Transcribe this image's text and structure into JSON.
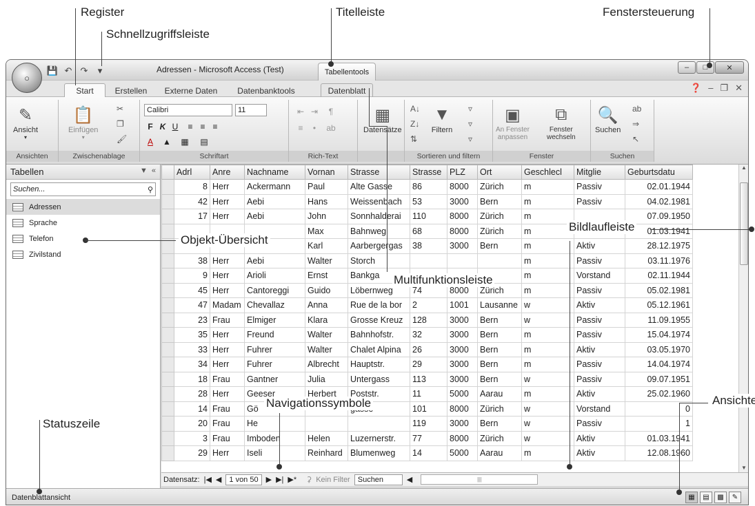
{
  "callouts": {
    "register": "Register",
    "schnellzugriff": "Schnellzugriffsleiste",
    "titelleiste": "Titelleiste",
    "fenstersteuerung": "Fenstersteuerung",
    "objektuebersicht": "Objekt-Übersicht",
    "bildlaufleiste": "Bildlaufleiste",
    "multifunktion": "Multifunktionsleiste",
    "statuszeile": "Statuszeile",
    "navigationssymbole": "Navigationssymbole",
    "ansichten": "Ansichten"
  },
  "window": {
    "title": "Adressen - Microsoft Access (Test)",
    "tool_tab": "Tabellentools"
  },
  "tabs": [
    "Start",
    "Erstellen",
    "Externe Daten",
    "Datenbanktools",
    "Datenblatt"
  ],
  "ribbon": {
    "groups": [
      "Ansichten",
      "Zwischenablage",
      "Schriftart",
      "Rich-Text",
      "",
      "Sortieren und filtern",
      "Fenster",
      "Suchen"
    ],
    "ansicht": "Ansicht",
    "einfuegen": "Einfügen",
    "font_name": "Calibri",
    "font_size": "11",
    "datensaetze": "Datensätze",
    "filtern": "Filtern",
    "an_fenster": "An Fenster",
    "anpassen": "anpassen",
    "fenster": "Fenster",
    "wechseln": "wechseln",
    "suchen": "Suchen"
  },
  "nav": {
    "header": "Tabellen",
    "search_placeholder": "Suchen...",
    "items": [
      "Adressen",
      "Sprache",
      "Telefon",
      "Zivilstand"
    ]
  },
  "table": {
    "columns": [
      "Adrl",
      "Anre",
      "Nachname",
      "Vornan",
      "Strasse",
      "Strasse",
      "PLZ",
      "Ort",
      "Geschlecl",
      "Mitglie",
      "Geburtsdatu"
    ],
    "rows": [
      [
        "8",
        "Herr",
        "Ackermann",
        "Paul",
        "Alte Gasse",
        "86",
        "8000",
        "Zürich",
        "m",
        "Passiv",
        "02.01.1944"
      ],
      [
        "42",
        "Herr",
        "Aebi",
        "Hans",
        "Weissenbach",
        "53",
        "3000",
        "Bern",
        "m",
        "Passiv",
        "04.02.1981"
      ],
      [
        "17",
        "Herr",
        "Aebi",
        "John",
        "Sonnhalderai",
        "110",
        "8000",
        "Zürich",
        "m",
        "",
        "07.09.1950"
      ],
      [
        "",
        "",
        "",
        "Max",
        "Bahnweg",
        "68",
        "8000",
        "Zürich",
        "m",
        "",
        "01.03.1941"
      ],
      [
        "",
        "",
        "",
        "Karl",
        "Aarbergergas",
        "38",
        "3000",
        "Bern",
        "m",
        "Aktiv",
        "28.12.1975"
      ],
      [
        "38",
        "Herr",
        "Aebi",
        "Walter",
        "Storch",
        "",
        "",
        "",
        "m",
        "Passiv",
        "03.11.1976"
      ],
      [
        "9",
        "Herr",
        "Arioli",
        "Ernst",
        "Bankga",
        "",
        "",
        "",
        "m",
        "Vorstand",
        "02.11.1944"
      ],
      [
        "45",
        "Herr",
        "Cantoreggi",
        "Guido",
        "Löbernweg",
        "74",
        "8000",
        "Zürich",
        "m",
        "Passiv",
        "05.02.1981"
      ],
      [
        "47",
        "Madam",
        "Chevallaz",
        "Anna",
        "Rue de la bor",
        "2",
        "1001",
        "Lausanne",
        "w",
        "Aktiv",
        "05.12.1961"
      ],
      [
        "23",
        "Frau",
        "Elmiger",
        "Klara",
        "Grosse Kreuz",
        "128",
        "3000",
        "Bern",
        "w",
        "Passiv",
        "11.09.1955"
      ],
      [
        "35",
        "Herr",
        "Freund",
        "Walter",
        "Bahnhofstr.",
        "32",
        "3000",
        "Bern",
        "m",
        "Passiv",
        "15.04.1974"
      ],
      [
        "33",
        "Herr",
        "Fuhrer",
        "Walter",
        "Chalet Alpina",
        "26",
        "3000",
        "Bern",
        "m",
        "Aktiv",
        "03.05.1970"
      ],
      [
        "34",
        "Herr",
        "Fuhrer",
        "Albrecht",
        "Hauptstr.",
        "29",
        "3000",
        "Bern",
        "m",
        "Passiv",
        "14.04.1974"
      ],
      [
        "18",
        "Frau",
        "Gantner",
        "Julia",
        "Untergass",
        "113",
        "3000",
        "Bern",
        "w",
        "Passiv",
        "09.07.1951"
      ],
      [
        "28",
        "Herr",
        "Geeser",
        "Herbert",
        "Poststr.",
        "11",
        "5000",
        "Aarau",
        "m",
        "Aktiv",
        "25.02.1960"
      ],
      [
        "14",
        "Frau",
        "Gö",
        "",
        "gasse",
        "101",
        "8000",
        "Zürich",
        "w",
        "Vorstand",
        "0"
      ],
      [
        "20",
        "Frau",
        "He",
        "",
        "",
        "119",
        "3000",
        "Bern",
        "w",
        "Passiv",
        "1"
      ],
      [
        "3",
        "Frau",
        "Imboden",
        "Helen",
        "Luzernerstr.",
        "77",
        "8000",
        "Zürich",
        "w",
        "Aktiv",
        "01.03.1941"
      ],
      [
        "29",
        "Herr",
        "Iseli",
        "Reinhard",
        "Blumenweg",
        "14",
        "5000",
        "Aarau",
        "m",
        "Aktiv",
        "12.08.1960"
      ]
    ]
  },
  "recnav": {
    "label": "Datensatz:",
    "position": "1 von 50",
    "filter": "Kein Filter",
    "search": "Suchen"
  },
  "status": {
    "text": "Datenblattansicht"
  }
}
